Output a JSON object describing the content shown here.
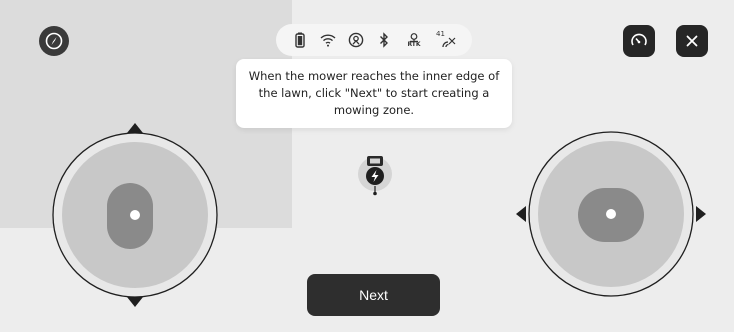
{
  "status_icons": [
    "battery-icon",
    "wifi-icon",
    "network-icon",
    "bluetooth-icon",
    "rtk-icon",
    "signal-strength-icon"
  ],
  "status_labels": {
    "rtk": "RTK",
    "signal": "41"
  },
  "top_left": {
    "icon": "compass-icon"
  },
  "top_right": {
    "speed_icon": "speedometer-icon",
    "close_icon": "close-icon"
  },
  "tooltip": {
    "line1": "When the mower reaches the inner edge of",
    "line2": "the lawn, click \"Next\" to start creating a",
    "line3": "mowing zone."
  },
  "joysticks": {
    "left": {
      "icon": "vertical-joystick",
      "directions": [
        "up",
        "down"
      ]
    },
    "right": {
      "icon": "horizontal-joystick",
      "directions": [
        "left",
        "right"
      ]
    }
  },
  "mower": {
    "icon": "mower-charging-icon"
  },
  "next_button": {
    "label": "Next"
  },
  "colors": {
    "background": "#ededed",
    "lawn": "#dcdcdc",
    "joystick_pad": "#c8c8c8",
    "joystick_knob": "#8a8a8a",
    "button_dark": "#2e2e2e"
  }
}
